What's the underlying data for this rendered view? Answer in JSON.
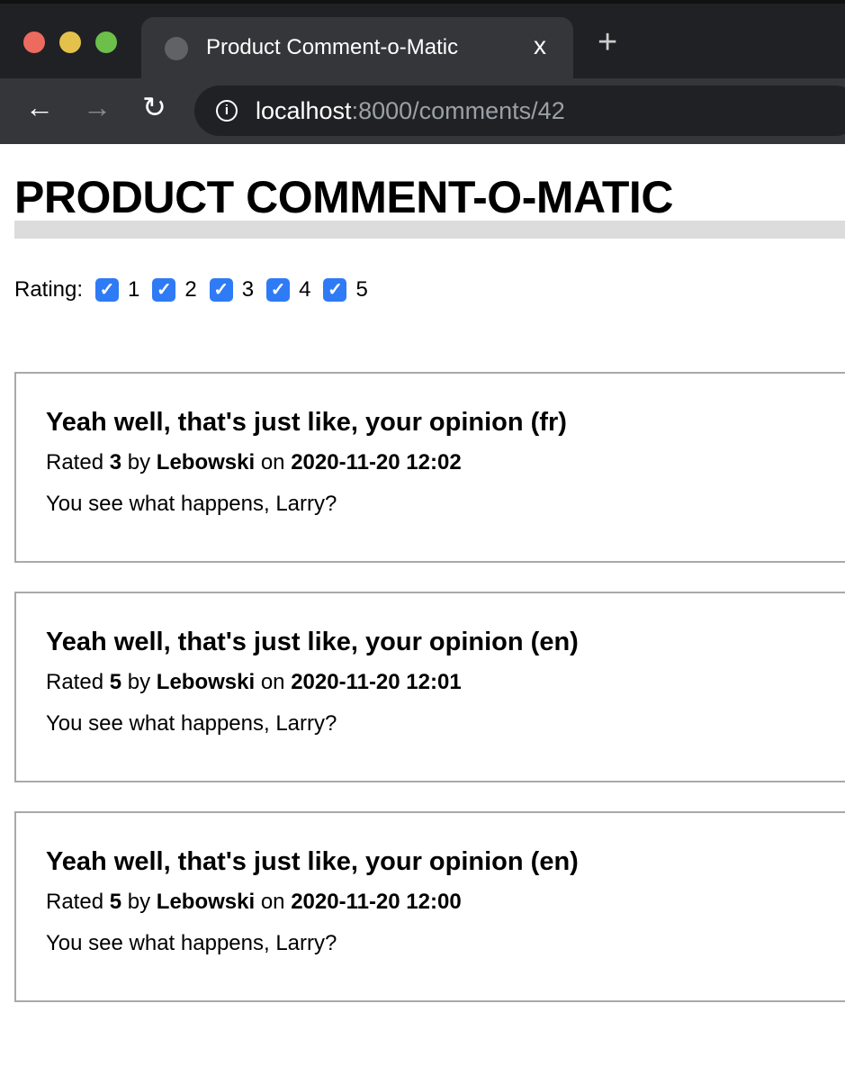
{
  "browser": {
    "tab_title": "Product Comment-o-Matic",
    "close": "x",
    "new_tab": "+",
    "url_host": "localhost",
    "url_rest": ":8000/comments/42",
    "back": "←",
    "forward": "→",
    "reload": "↻",
    "info": "i",
    "colors": {
      "close": "#ed6a5e",
      "minimize": "#e4c14b",
      "maximize": "#6cc04a"
    }
  },
  "page": {
    "title": "PRODUCT COMMENT-O-MATIC"
  },
  "filter": {
    "label": "Rating:",
    "options": [
      {
        "label": "1",
        "checked": true
      },
      {
        "label": "2",
        "checked": true
      },
      {
        "label": "3",
        "checked": true
      },
      {
        "label": "4",
        "checked": true
      },
      {
        "label": "5",
        "checked": true
      }
    ],
    "check": "✓"
  },
  "comments": [
    {
      "title": "Yeah well, that's just like, your opinion (fr)",
      "rated_label": "Rated",
      "rating": "3",
      "by_label": "by",
      "author": "Lebowski",
      "on_label": "on",
      "date": "2020-11-20 12:02",
      "body": "You see what happens, Larry?"
    },
    {
      "title": "Yeah well, that's just like, your opinion (en)",
      "rated_label": "Rated",
      "rating": "5",
      "by_label": "by",
      "author": "Lebowski",
      "on_label": "on",
      "date": "2020-11-20 12:01",
      "body": "You see what happens, Larry?"
    },
    {
      "title": "Yeah well, that's just like, your opinion (en)",
      "rated_label": "Rated",
      "rating": "5",
      "by_label": "by",
      "author": "Lebowski",
      "on_label": "on",
      "date": "2020-11-20 12:00",
      "body": "You see what happens, Larry?"
    }
  ]
}
